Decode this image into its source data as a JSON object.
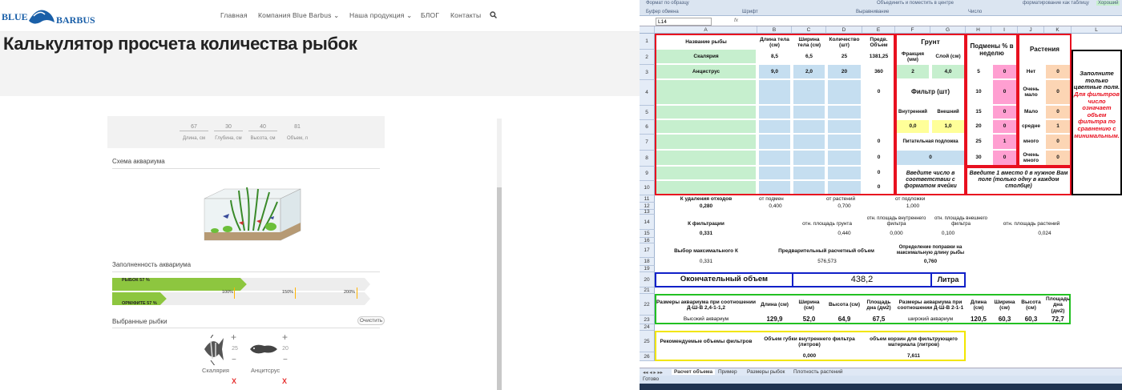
{
  "website": {
    "logo": {
      "line1": "BLUE",
      "line2": "BARBUS"
    },
    "nav": [
      {
        "label": "Главная"
      },
      {
        "label": "Компания Blue Barbus"
      },
      {
        "label": "Наша продукция"
      },
      {
        "label": "БЛОГ"
      },
      {
        "label": "Контакты"
      }
    ],
    "title": "Калькулятор просчета количества рыбок",
    "dimensions": [
      {
        "value": "67",
        "label": "Длина, см"
      },
      {
        "value": "30",
        "label": "Глубина, см"
      },
      {
        "value": "40",
        "label": "Высота, см"
      },
      {
        "value": "81",
        "label": "Объем, л"
      }
    ],
    "scheme_title": "Схема аквариума",
    "fill_title": "Заполненность аквариума",
    "fill_bars": [
      {
        "label": "РЫБОК 57 %",
        "percent": 57
      },
      {
        "label": "ОРМ/ФИТЕ 57 %",
        "percent": 57
      }
    ],
    "fill_markers": [
      "100%",
      "150%",
      "200%"
    ],
    "selected_title": "Выбранные рыбки",
    "clear_label": "Очистить",
    "fish": [
      {
        "name": "Скалярия",
        "count": "25",
        "remove": "X"
      },
      {
        "name": "Анцитсрус",
        "count": "20",
        "remove": "X"
      }
    ]
  },
  "excel": {
    "ribbon": {
      "paste_format": "Формат по образцу",
      "clipboard": "Буфер обмена",
      "font": "Шрифт",
      "alignment": "Выравнивание",
      "merge": "Объединить и поместить в центре",
      "number": "Число",
      "conditional": "форматирование",
      "as_table": "как таблицу",
      "good": "Хороший"
    },
    "name_box": "L14",
    "fx": "fx",
    "columns": [
      "A",
      "B",
      "C",
      "D",
      "E",
      "F",
      "G",
      "H",
      "I",
      "J",
      "K",
      "L"
    ],
    "rows": [
      "1",
      "2",
      "3",
      "4",
      "5",
      "6",
      "7",
      "8",
      "9",
      "10",
      "11",
      "12",
      "13",
      "14",
      "15",
      "16",
      "17",
      "18",
      "19",
      "20",
      "21",
      "22",
      "23",
      "24",
      "25",
      "26"
    ],
    "headers": {
      "name": "Название рыбы",
      "len": "Длина тела (см)",
      "wid": "Ширина тела (см)",
      "qty": "Количество (шт)",
      "pvol": "Предв. Объем",
      "soil": "Грунт",
      "frac": "Фракция (мм)",
      "layer": "Слой (см)",
      "weekly": "Подмены % в неделю",
      "plants": "Растения"
    },
    "fish_rows": [
      {
        "name": "Скалярия",
        "len": "8,5",
        "wid": "6,5",
        "qty": "25",
        "vol": "1381,25",
        "frac": "2",
        "layer": "4,0"
      },
      {
        "name": "Анциструс",
        "len": "9,0",
        "wid": "2,0",
        "qty": "20",
        "vol": "360"
      }
    ],
    "zeros": [
      "0",
      "0",
      "0",
      "0",
      "0",
      "0"
    ],
    "filter_label": "Фильтр (шт)",
    "inner": "Внутренний",
    "outer": "Внешний",
    "inner_val": "0,0",
    "outer_val": "1,0",
    "substrate": "Питательная подложка",
    "substrate_val": "0",
    "format_hint": "Введите число в соответствии с форматом ячейки",
    "weekly_rows": [
      {
        "p": "5",
        "v": "0"
      },
      {
        "p": "10",
        "v": "0"
      },
      {
        "p": "15",
        "v": "0"
      },
      {
        "p": "20",
        "v": "0"
      },
      {
        "p": "25",
        "v": "1"
      },
      {
        "p": "30",
        "v": "0"
      }
    ],
    "plant_rows": [
      {
        "p": "Нет",
        "v": "0"
      },
      {
        "p": "Очень мало",
        "v": "0"
      },
      {
        "p": "Мало",
        "v": "0"
      },
      {
        "p": "средне",
        "v": "1"
      },
      {
        "p": "много",
        "v": "0"
      },
      {
        "p": "Очень много",
        "v": "0"
      }
    ],
    "weekly_hint": "Введите 1 вместо 0 в нужное Вам поле (только одну в каждом столбце)",
    "side_note_black": "Заполните только цветные поля.",
    "side_note_red": "Для фильтров число означает объем фильтра по сравнению с минимальным.",
    "k_waste": "К удаления отходов",
    "k_waste_val": "0,280",
    "from_changes": "от подмен",
    "from_changes_val": "0,400",
    "from_plants": "от растений",
    "from_plants_val": "0,700",
    "from_substrate": "от подложки",
    "from_substrate_val": "1,000",
    "k_filter": "К фильтрации",
    "k_filter_val": "0,331",
    "rel_soil": "отн. площадь грунта",
    "rel_soil_val": "0,440",
    "rel_inner": "отн. площадь внутреннего фильтра",
    "rel_inner_val": "0,000",
    "rel_outer": "отн. площадь внешнего фильтра",
    "rel_outer_val": "0,100",
    "rel_plants": "отн. площадь растений",
    "rel_plants_val": "0,024",
    "kmax": "Выбор максимального К",
    "kmax_val": "0,331",
    "prelim": "Предварительный расчетный объем",
    "prelim_val": "576,573",
    "corr": "Определение поправки на максимальную длину рыбы",
    "corr_val": "0,760",
    "final_label": "Окончательный объем",
    "final_val": "438,2",
    "final_unit": "Литра",
    "sizes1": "Размеры аквариума при соотношении Д-Ш-В 2,4-1-1,2",
    "sizes2": "Размеры аквариума при соотношении Д-Ш-В 2-1-1",
    "len": "Длина (см)",
    "wid": "Ширина (см)",
    "hei": "Высота (см)",
    "area": "Площадь дна (дм2)",
    "high": "Высокий аквариум",
    "high_vals": [
      "129,9",
      "52,0",
      "64,9",
      "67,5"
    ],
    "wide": "широкий аквариум",
    "wide_vals": [
      "120,5",
      "60,3",
      "60,3",
      "72,7"
    ],
    "rec": "Рекомендуемые объемы фильтров",
    "sponge": "Объем губки внутреннего фильтра (литров)",
    "sponge_val": "0,000",
    "basket": "объем корзин для фильтрующего материала (литров)",
    "basket_val": "7,611",
    "tabs": [
      "Расчет объема",
      "Пример",
      "Размеры рыбок",
      "Плотность растений"
    ],
    "status": "Готово"
  }
}
